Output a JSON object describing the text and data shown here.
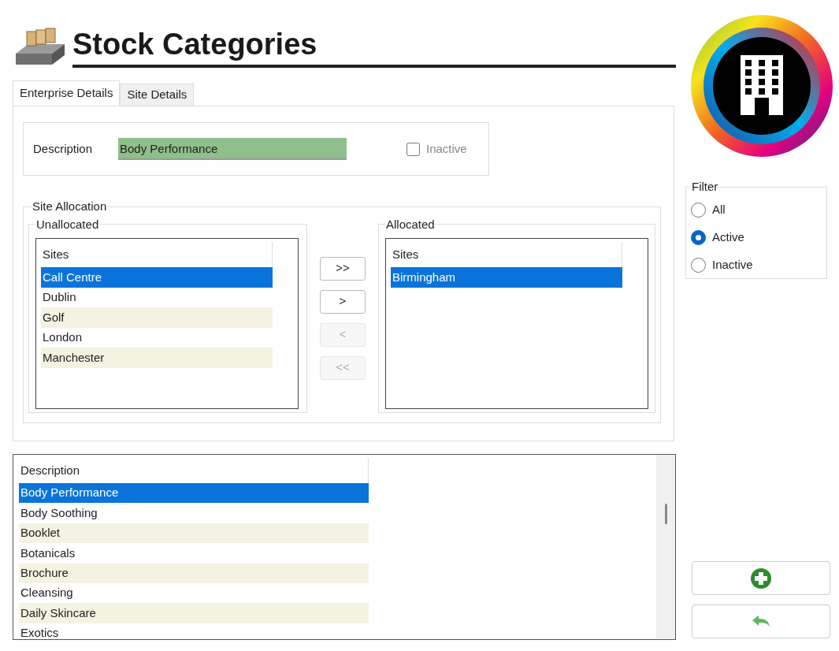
{
  "header": {
    "title": "Stock Categories"
  },
  "tabs": [
    {
      "label": "Enterprise Details",
      "selected": true
    },
    {
      "label": "Site Details",
      "selected": false
    }
  ],
  "description": {
    "label": "Description",
    "value": "Body Performance"
  },
  "inactive": {
    "label": "Inactive",
    "checked": false
  },
  "site_allocation": {
    "title": "Site Allocation",
    "unallocated": {
      "title": "Unallocated",
      "column": "Sites",
      "rows": [
        {
          "name": "Call Centre",
          "selected": true
        },
        {
          "name": "Dublin",
          "selected": false
        },
        {
          "name": "Golf",
          "selected": false
        },
        {
          "name": "London",
          "selected": false
        },
        {
          "name": "Manchester",
          "selected": false
        }
      ]
    },
    "buttons": [
      {
        "label": ">>",
        "disabled": false
      },
      {
        "label": ">",
        "disabled": false
      },
      {
        "label": "<",
        "disabled": true
      },
      {
        "label": "<<",
        "disabled": true
      }
    ],
    "allocated": {
      "title": "Allocated",
      "column": "Sites",
      "rows": [
        {
          "name": "Birmingham",
          "selected": true
        }
      ]
    }
  },
  "filter": {
    "title": "Filter",
    "options": [
      {
        "label": "All",
        "selected": false
      },
      {
        "label": "Active",
        "selected": true
      },
      {
        "label": "Inactive",
        "selected": false
      }
    ]
  },
  "categories": {
    "column": "Description",
    "rows": [
      {
        "name": "Body Performance",
        "selected": true
      },
      {
        "name": "Body Soothing",
        "selected": false
      },
      {
        "name": "Booklet",
        "selected": false
      },
      {
        "name": "Botanicals",
        "selected": false
      },
      {
        "name": "Brochure",
        "selected": false
      },
      {
        "name": "Cleansing",
        "selected": false
      },
      {
        "name": "Daily Skincare",
        "selected": false
      },
      {
        "name": "Exotics",
        "selected": false
      }
    ]
  }
}
